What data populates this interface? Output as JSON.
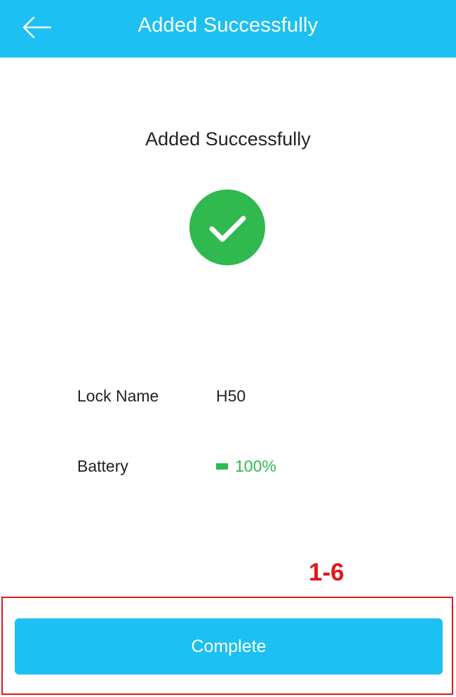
{
  "header": {
    "title": "Added Successfully",
    "back_icon": "arrow-left-icon",
    "background_color": "#1cc0f2"
  },
  "status": {
    "title": "Added Successfully",
    "icon": "check-circle-icon",
    "icon_color": "#2fb94e"
  },
  "lock_info": {
    "name_label": "Lock Name",
    "name_value": "H50",
    "battery_label": "Battery",
    "battery_icon": "battery-icon",
    "battery_value": "100%",
    "battery_color": "#2fb94e"
  },
  "annotation": {
    "label": "1-6",
    "color": "#e0161b"
  },
  "footer": {
    "complete_label": "Complete",
    "button_color": "#1cc0f2"
  }
}
